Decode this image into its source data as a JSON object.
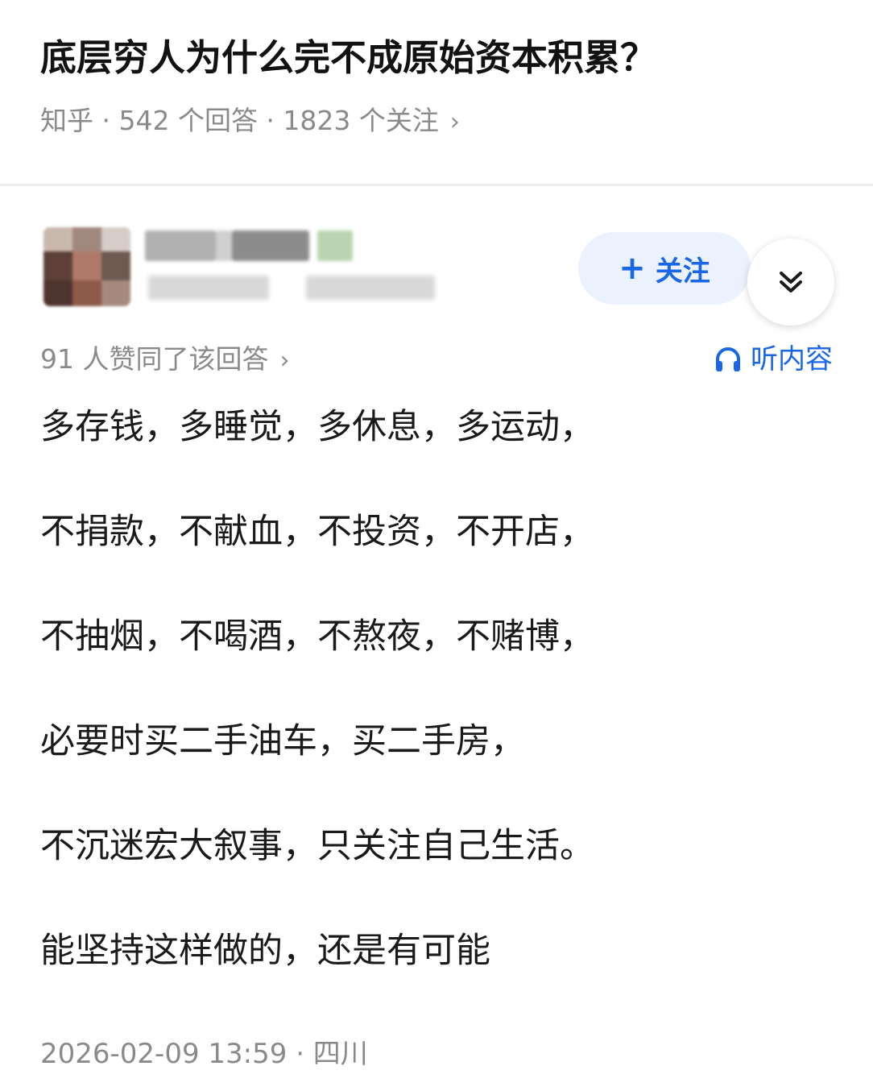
{
  "question": {
    "title": "底层穷人为什么完不成原始资本积累？",
    "meta": "知乎 · 542 个回答 · 1823 个关注",
    "meta_chevron": "›"
  },
  "author": {
    "follow_label": "关注",
    "follow_icon": "plus-icon",
    "expand_icon": "double-chevron-down-icon"
  },
  "answer": {
    "upvote_text": "91 人赞同了该回答",
    "upvote_chevron": "›",
    "listen_label": "听内容",
    "listen_icon": "headphones-icon",
    "paragraphs": [
      "多存钱，多睡觉，多休息，多运动，",
      "不捐款，不献血，不投资，不开店，",
      "不抽烟，不喝酒，不熬夜，不赌博，",
      "必要时买二手油车，买二手房，",
      "不沉迷宏大叙事，只关注自己生活。",
      "能坚持这样做的，还是有可能"
    ],
    "footer": "2026-02-09 13:59 · 四川"
  },
  "colors": {
    "accent": "#1966e6",
    "follow_bg": "#ebf2fd",
    "meta_gray": "#8a8a8a"
  }
}
